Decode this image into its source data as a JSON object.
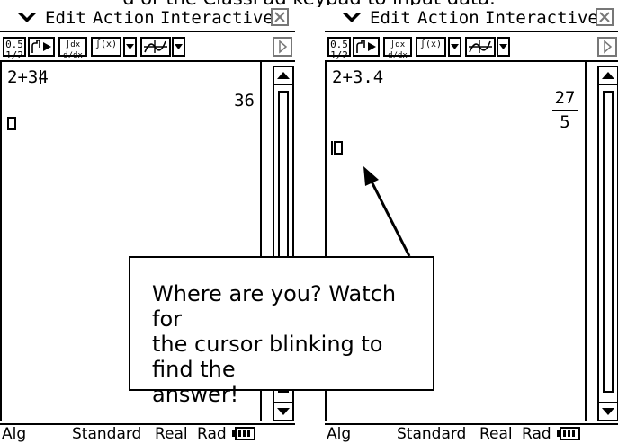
{
  "header_cut_text": "d or the ClassPad keypad to input data.",
  "screens": [
    {
      "menu": [
        "Edit",
        "Action",
        "Interactive"
      ],
      "toolbar_labels": [
        "0.5 1/2",
        "",
        "∫dx d/dx",
        "∫(x)",
        "",
        ""
      ],
      "lines": [
        {
          "text": "2+34",
          "answer": "36"
        }
      ],
      "status": {
        "mode": "Alg",
        "format": "Standard",
        "number": "Real",
        "angle": "Rad"
      }
    },
    {
      "menu": [
        "Edit",
        "Action",
        "Interactive"
      ],
      "toolbar_labels": [
        "0.5 1/2",
        "",
        "∫dx d/dx",
        "∫(x)",
        "",
        ""
      ],
      "lines": [
        {
          "text": "2+3.4",
          "answer_num": "27",
          "answer_den": "5"
        }
      ],
      "status": {
        "mode": "Alg",
        "format": "Standard",
        "number": "Real",
        "angle": "Rad"
      }
    }
  ],
  "callout": {
    "text": "Where are you? Watch for\nthe cursor blinking to find the\nanswer!"
  },
  "icons": [
    "dropdown-triangle-icon",
    "close-icon",
    "scroll-up-icon",
    "scroll-down-icon",
    "battery-icon",
    "arrow-pointer"
  ]
}
